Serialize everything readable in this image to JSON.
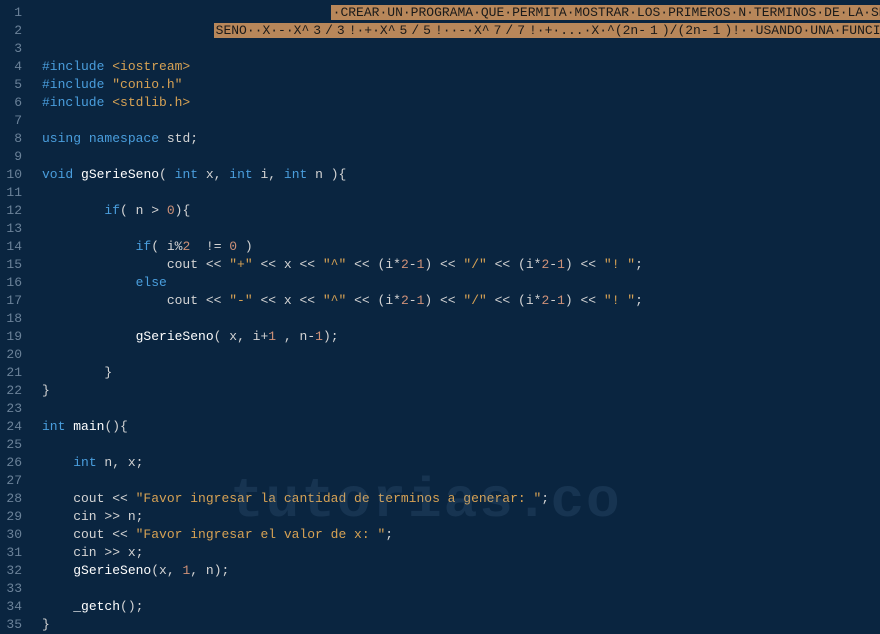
{
  "watermark": "tutorias.co",
  "lines": [
    {
      "num": 1,
      "segments": [
        {
          "cls": "",
          "txt": "                                     "
        },
        {
          "cls": "highlight-bg",
          "txt": "·CREAR·UN·PROGRAMA·QUE·PERMITA·MOSTRAR·LOS·PRIMEROS·N·TERMINOS·DE·LA·SERIE"
        }
      ]
    },
    {
      "num": 2,
      "segments": [
        {
          "cls": "",
          "txt": "                      "
        },
        {
          "cls": "highlight-bg",
          "txt": "SENO··X·-·X^"
        },
        {
          "cls": "highlight-bg number",
          "txt": "3"
        },
        {
          "cls": "highlight-bg",
          "txt": "/"
        },
        {
          "cls": "highlight-bg number",
          "txt": "3"
        },
        {
          "cls": "highlight-bg",
          "txt": "!·+·X^"
        },
        {
          "cls": "highlight-bg number",
          "txt": "5"
        },
        {
          "cls": "highlight-bg",
          "txt": "/"
        },
        {
          "cls": "highlight-bg number",
          "txt": "5"
        },
        {
          "cls": "highlight-bg",
          "txt": "!··-·X^"
        },
        {
          "cls": "highlight-bg number",
          "txt": "7"
        },
        {
          "cls": "highlight-bg",
          "txt": "/"
        },
        {
          "cls": "highlight-bg number",
          "txt": "7"
        },
        {
          "cls": "highlight-bg",
          "txt": "!·+·...·X·^(2n-"
        },
        {
          "cls": "highlight-bg number",
          "txt": "1"
        },
        {
          "cls": "highlight-bg",
          "txt": ")/(2n-"
        },
        {
          "cls": "highlight-bg number",
          "txt": "1"
        },
        {
          "cls": "highlight-bg",
          "txt": ")!··USANDO·UNA·FUNCIÓN·RECURSIVA"
        }
      ]
    },
    {
      "num": 3,
      "segments": []
    },
    {
      "num": 4,
      "segments": [
        {
          "cls": "preprocessor",
          "txt": "#include "
        },
        {
          "cls": "include-lib",
          "txt": "<iostream>"
        }
      ]
    },
    {
      "num": 5,
      "segments": [
        {
          "cls": "preprocessor",
          "txt": "#include "
        },
        {
          "cls": "include-lib",
          "txt": "\"conio.h\""
        }
      ]
    },
    {
      "num": 6,
      "segments": [
        {
          "cls": "preprocessor",
          "txt": "#include "
        },
        {
          "cls": "include-lib",
          "txt": "<stdlib.h>"
        }
      ]
    },
    {
      "num": 7,
      "segments": []
    },
    {
      "num": 8,
      "segments": [
        {
          "cls": "keyword",
          "txt": "using"
        },
        {
          "cls": "",
          "txt": " "
        },
        {
          "cls": "keyword",
          "txt": "namespace"
        },
        {
          "cls": "",
          "txt": " std"
        },
        {
          "cls": "punct",
          "txt": ";"
        }
      ]
    },
    {
      "num": 9,
      "segments": []
    },
    {
      "num": 10,
      "segments": [
        {
          "cls": "keyword",
          "txt": "void"
        },
        {
          "cls": "",
          "txt": " "
        },
        {
          "cls": "func-name",
          "txt": "gSerieSeno"
        },
        {
          "cls": "punct",
          "txt": "( "
        },
        {
          "cls": "type",
          "txt": "int"
        },
        {
          "cls": "",
          "txt": " x"
        },
        {
          "cls": "punct",
          "txt": ", "
        },
        {
          "cls": "type",
          "txt": "int"
        },
        {
          "cls": "",
          "txt": " i"
        },
        {
          "cls": "punct",
          "txt": ", "
        },
        {
          "cls": "type",
          "txt": "int"
        },
        {
          "cls": "",
          "txt": " n "
        },
        {
          "cls": "punct",
          "txt": "){"
        }
      ]
    },
    {
      "num": 11,
      "segments": []
    },
    {
      "num": 12,
      "segments": [
        {
          "cls": "",
          "txt": "        "
        },
        {
          "cls": "keyword",
          "txt": "if"
        },
        {
          "cls": "punct",
          "txt": "( "
        },
        {
          "cls": "",
          "txt": "n "
        },
        {
          "cls": "operator",
          "txt": "> "
        },
        {
          "cls": "number",
          "txt": "0"
        },
        {
          "cls": "punct",
          "txt": "){"
        }
      ]
    },
    {
      "num": 13,
      "segments": []
    },
    {
      "num": 14,
      "segments": [
        {
          "cls": "",
          "txt": "            "
        },
        {
          "cls": "keyword",
          "txt": "if"
        },
        {
          "cls": "punct",
          "txt": "( "
        },
        {
          "cls": "",
          "txt": "i"
        },
        {
          "cls": "operator",
          "txt": "%"
        },
        {
          "cls": "number",
          "txt": "2"
        },
        {
          "cls": "",
          "txt": "  "
        },
        {
          "cls": "operator",
          "txt": "!= "
        },
        {
          "cls": "number",
          "txt": "0"
        },
        {
          "cls": "",
          "txt": " "
        },
        {
          "cls": "punct",
          "txt": ")"
        }
      ]
    },
    {
      "num": 15,
      "segments": [
        {
          "cls": "",
          "txt": "                cout "
        },
        {
          "cls": "operator",
          "txt": "<< "
        },
        {
          "cls": "string",
          "txt": "\"+\""
        },
        {
          "cls": "",
          "txt": " "
        },
        {
          "cls": "operator",
          "txt": "<< "
        },
        {
          "cls": "",
          "txt": "x "
        },
        {
          "cls": "operator",
          "txt": "<< "
        },
        {
          "cls": "string",
          "txt": "\"^\""
        },
        {
          "cls": "",
          "txt": " "
        },
        {
          "cls": "operator",
          "txt": "<< "
        },
        {
          "cls": "punct",
          "txt": "("
        },
        {
          "cls": "",
          "txt": "i"
        },
        {
          "cls": "operator",
          "txt": "*"
        },
        {
          "cls": "number",
          "txt": "2"
        },
        {
          "cls": "operator",
          "txt": "-"
        },
        {
          "cls": "number",
          "txt": "1"
        },
        {
          "cls": "punct",
          "txt": ") "
        },
        {
          "cls": "operator",
          "txt": "<< "
        },
        {
          "cls": "string",
          "txt": "\"/\""
        },
        {
          "cls": "",
          "txt": " "
        },
        {
          "cls": "operator",
          "txt": "<< "
        },
        {
          "cls": "punct",
          "txt": "("
        },
        {
          "cls": "",
          "txt": "i"
        },
        {
          "cls": "operator",
          "txt": "*"
        },
        {
          "cls": "number",
          "txt": "2"
        },
        {
          "cls": "operator",
          "txt": "-"
        },
        {
          "cls": "number",
          "txt": "1"
        },
        {
          "cls": "punct",
          "txt": ") "
        },
        {
          "cls": "operator",
          "txt": "<< "
        },
        {
          "cls": "string",
          "txt": "\"! \""
        },
        {
          "cls": "punct",
          "txt": ";"
        }
      ]
    },
    {
      "num": 16,
      "segments": [
        {
          "cls": "",
          "txt": "            "
        },
        {
          "cls": "keyword",
          "txt": "else"
        }
      ]
    },
    {
      "num": 17,
      "segments": [
        {
          "cls": "",
          "txt": "                cout "
        },
        {
          "cls": "operator",
          "txt": "<< "
        },
        {
          "cls": "string",
          "txt": "\"-\""
        },
        {
          "cls": "",
          "txt": " "
        },
        {
          "cls": "operator",
          "txt": "<< "
        },
        {
          "cls": "",
          "txt": "x "
        },
        {
          "cls": "operator",
          "txt": "<< "
        },
        {
          "cls": "string",
          "txt": "\"^\""
        },
        {
          "cls": "",
          "txt": " "
        },
        {
          "cls": "operator",
          "txt": "<< "
        },
        {
          "cls": "punct",
          "txt": "("
        },
        {
          "cls": "",
          "txt": "i"
        },
        {
          "cls": "operator",
          "txt": "*"
        },
        {
          "cls": "number",
          "txt": "2"
        },
        {
          "cls": "operator",
          "txt": "-"
        },
        {
          "cls": "number",
          "txt": "1"
        },
        {
          "cls": "punct",
          "txt": ") "
        },
        {
          "cls": "operator",
          "txt": "<< "
        },
        {
          "cls": "string",
          "txt": "\"/\""
        },
        {
          "cls": "",
          "txt": " "
        },
        {
          "cls": "operator",
          "txt": "<< "
        },
        {
          "cls": "punct",
          "txt": "("
        },
        {
          "cls": "",
          "txt": "i"
        },
        {
          "cls": "operator",
          "txt": "*"
        },
        {
          "cls": "number",
          "txt": "2"
        },
        {
          "cls": "operator",
          "txt": "-"
        },
        {
          "cls": "number",
          "txt": "1"
        },
        {
          "cls": "punct",
          "txt": ") "
        },
        {
          "cls": "operator",
          "txt": "<< "
        },
        {
          "cls": "string",
          "txt": "\"! \""
        },
        {
          "cls": "punct",
          "txt": ";"
        }
      ]
    },
    {
      "num": 18,
      "segments": []
    },
    {
      "num": 19,
      "segments": [
        {
          "cls": "",
          "txt": "            "
        },
        {
          "cls": "func-name",
          "txt": "gSerieSeno"
        },
        {
          "cls": "punct",
          "txt": "( "
        },
        {
          "cls": "",
          "txt": "x"
        },
        {
          "cls": "punct",
          "txt": ", "
        },
        {
          "cls": "",
          "txt": "i"
        },
        {
          "cls": "operator",
          "txt": "+"
        },
        {
          "cls": "number",
          "txt": "1"
        },
        {
          "cls": "",
          "txt": " "
        },
        {
          "cls": "punct",
          "txt": ", "
        },
        {
          "cls": "",
          "txt": "n"
        },
        {
          "cls": "operator",
          "txt": "-"
        },
        {
          "cls": "number",
          "txt": "1"
        },
        {
          "cls": "punct",
          "txt": ");"
        }
      ]
    },
    {
      "num": 20,
      "segments": []
    },
    {
      "num": 21,
      "segments": [
        {
          "cls": "",
          "txt": "        "
        },
        {
          "cls": "punct",
          "txt": "}"
        }
      ]
    },
    {
      "num": 22,
      "segments": [
        {
          "cls": "punct",
          "txt": "}"
        }
      ]
    },
    {
      "num": 23,
      "segments": []
    },
    {
      "num": 24,
      "segments": [
        {
          "cls": "type",
          "txt": "int"
        },
        {
          "cls": "",
          "txt": " "
        },
        {
          "cls": "func-name",
          "txt": "main"
        },
        {
          "cls": "punct",
          "txt": "(){"
        }
      ]
    },
    {
      "num": 25,
      "segments": []
    },
    {
      "num": 26,
      "segments": [
        {
          "cls": "",
          "txt": "    "
        },
        {
          "cls": "type",
          "txt": "int"
        },
        {
          "cls": "",
          "txt": " n"
        },
        {
          "cls": "punct",
          "txt": ", "
        },
        {
          "cls": "",
          "txt": "x"
        },
        {
          "cls": "punct",
          "txt": ";"
        }
      ]
    },
    {
      "num": 27,
      "segments": []
    },
    {
      "num": 28,
      "segments": [
        {
          "cls": "",
          "txt": "    cout "
        },
        {
          "cls": "operator",
          "txt": "<< "
        },
        {
          "cls": "string",
          "txt": "\"Favor ingresar la cantidad de terminos a generar: \""
        },
        {
          "cls": "punct",
          "txt": ";"
        }
      ]
    },
    {
      "num": 29,
      "segments": [
        {
          "cls": "",
          "txt": "    cin "
        },
        {
          "cls": "operator",
          "txt": ">> "
        },
        {
          "cls": "",
          "txt": "n"
        },
        {
          "cls": "punct",
          "txt": ";"
        }
      ]
    },
    {
      "num": 30,
      "segments": [
        {
          "cls": "",
          "txt": "    cout "
        },
        {
          "cls": "operator",
          "txt": "<< "
        },
        {
          "cls": "string",
          "txt": "\"Favor ingresar el valor de x: \""
        },
        {
          "cls": "punct",
          "txt": ";"
        }
      ]
    },
    {
      "num": 31,
      "segments": [
        {
          "cls": "",
          "txt": "    cin "
        },
        {
          "cls": "operator",
          "txt": ">> "
        },
        {
          "cls": "",
          "txt": "x"
        },
        {
          "cls": "punct",
          "txt": ";"
        }
      ]
    },
    {
      "num": 32,
      "segments": [
        {
          "cls": "",
          "txt": "    "
        },
        {
          "cls": "func-name",
          "txt": "gSerieSeno"
        },
        {
          "cls": "punct",
          "txt": "("
        },
        {
          "cls": "",
          "txt": "x"
        },
        {
          "cls": "punct",
          "txt": ", "
        },
        {
          "cls": "number",
          "txt": "1"
        },
        {
          "cls": "punct",
          "txt": ", "
        },
        {
          "cls": "",
          "txt": "n"
        },
        {
          "cls": "punct",
          "txt": ");"
        }
      ]
    },
    {
      "num": 33,
      "segments": []
    },
    {
      "num": 34,
      "segments": [
        {
          "cls": "",
          "txt": "    "
        },
        {
          "cls": "func-name",
          "txt": "_getch"
        },
        {
          "cls": "punct",
          "txt": "();"
        }
      ]
    },
    {
      "num": 35,
      "segments": [
        {
          "cls": "punct",
          "txt": "}"
        }
      ]
    }
  ]
}
